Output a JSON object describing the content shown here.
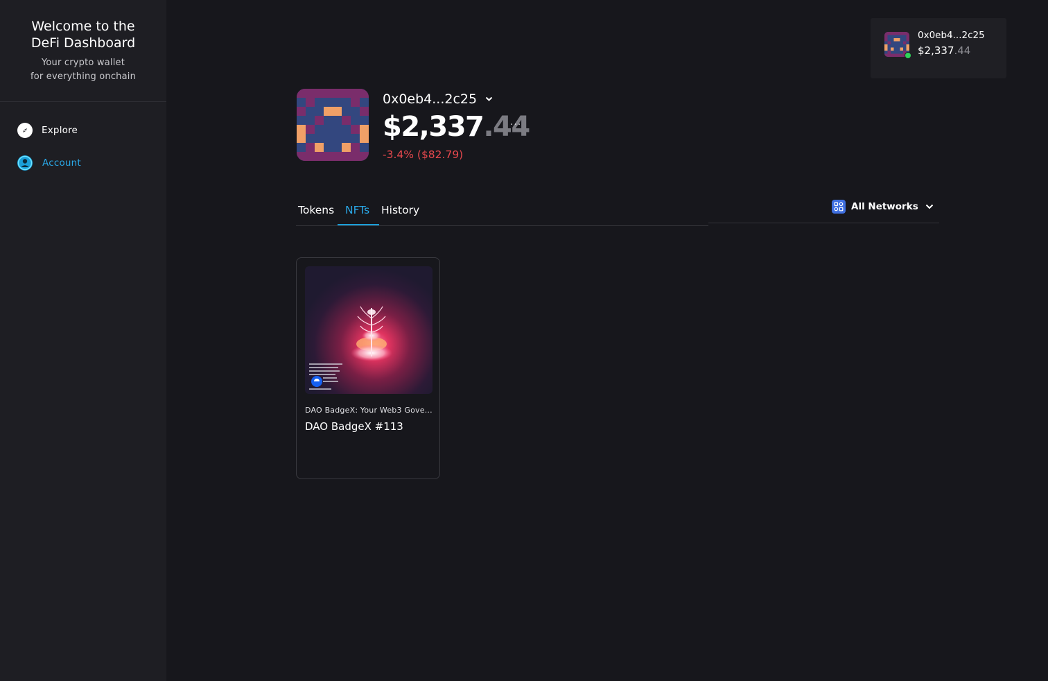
{
  "sidebar": {
    "title": "Welcome to the DeFi Dashboard",
    "subtitle_line1": "Your crypto wallet",
    "subtitle_line2": "for everything onchain",
    "items": [
      {
        "label": "Explore",
        "icon": "compass-icon",
        "active": false
      },
      {
        "label": "Account",
        "icon": "user-icon",
        "active": true
      }
    ]
  },
  "wallet_chip": {
    "address": "0x0eb4...2c25",
    "balance_main": "$2,337",
    "balance_cents": ".44",
    "status_color": "#2fd35a"
  },
  "profile": {
    "address": "0x0eb4...2c25",
    "balance_main": "$2,337",
    "balance_cents": ".44",
    "change": "-3.4% ($82.79)",
    "more_label": "···"
  },
  "tabs": [
    {
      "label": "Tokens",
      "active": false
    },
    {
      "label": "NFTs",
      "active": true
    },
    {
      "label": "History",
      "active": false
    }
  ],
  "network_filter": {
    "label": "All Networks",
    "icon": "networks-icon"
  },
  "nfts": [
    {
      "collection": "DAO BadgeX: Your Web3 Gove...",
      "name": "DAO BadgeX #113"
    }
  ],
  "colors": {
    "accent": "#2aa7e6",
    "negative": "#e5484d",
    "background": "#17171c",
    "sidebar": "#1e1e23"
  }
}
